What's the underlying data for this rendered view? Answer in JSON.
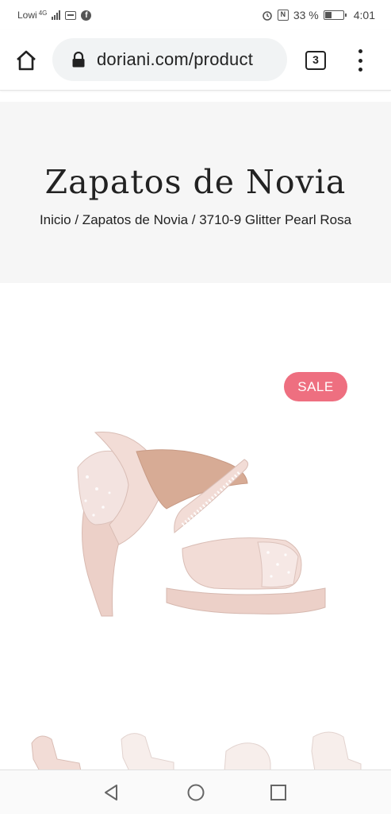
{
  "status_bar": {
    "carrier": "Lowi",
    "network": "4G",
    "battery": "33 %",
    "time": "4:01"
  },
  "browser": {
    "url": "doriani.com/product",
    "tab_count": "3"
  },
  "page": {
    "title": "Zapatos de Novia",
    "breadcrumb": "Inicio / Zapatos de Novia / 3710-9 Glitter Pearl Rosa"
  },
  "product": {
    "badge": "SALE",
    "badge_color": "#ee6f80",
    "product_color": "#f2dcd6"
  },
  "icons": {
    "home": "home-icon",
    "lock": "lock-icon",
    "menu": "more-vert-icon",
    "nav_back": "back-triangle-icon",
    "nav_home": "home-circle-icon",
    "nav_recent": "recent-square-icon"
  }
}
